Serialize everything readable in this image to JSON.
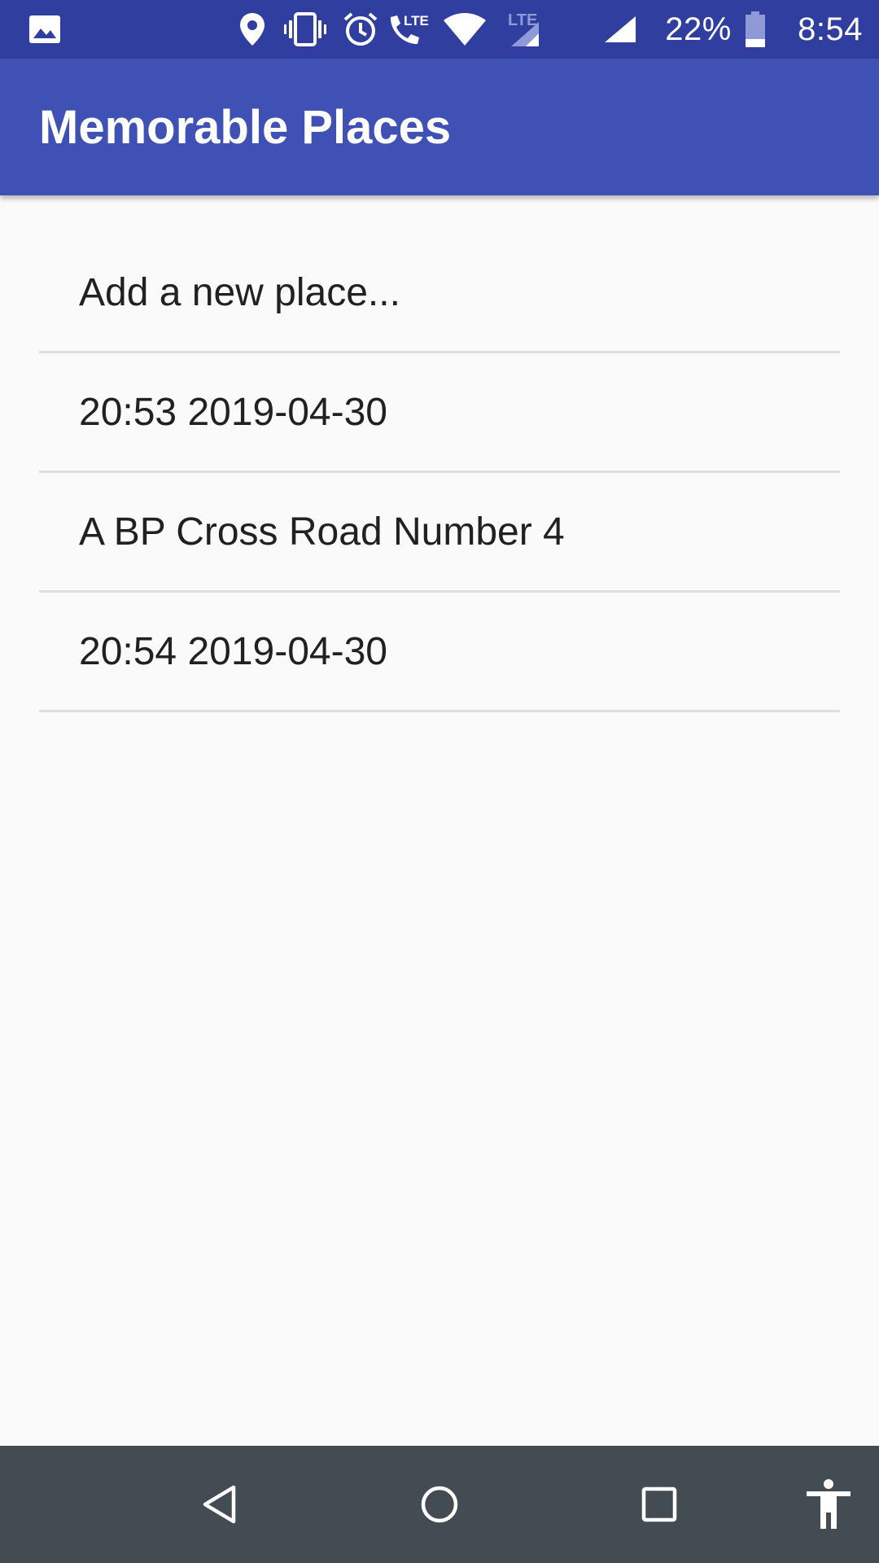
{
  "status_bar": {
    "battery_percent": "22%",
    "time": "8:54",
    "network_label": "LTE",
    "icons": [
      "gallery-icon",
      "location-icon",
      "vibrate-icon",
      "alarm-icon",
      "volte-call-icon",
      "wifi-icon",
      "signal-lte-icon",
      "signal-icon",
      "battery-icon"
    ]
  },
  "app_bar": {
    "title": "Memorable Places"
  },
  "places": {
    "items": [
      {
        "label": "Add a new place..."
      },
      {
        "label": "20:53 2019-04-30"
      },
      {
        "label": "A BP Cross Road Number 4"
      },
      {
        "label": "20:54 2019-04-30"
      }
    ]
  },
  "nav_bar": {
    "icons": [
      "back-icon",
      "home-icon",
      "recents-icon",
      "accessibility-icon"
    ]
  },
  "colors": {
    "status_bar": "#303f9f",
    "app_bar": "#3f51b5",
    "background": "#fafafa",
    "nav_bar": "#444c53",
    "divider": "#dedede",
    "text": "#212121"
  }
}
